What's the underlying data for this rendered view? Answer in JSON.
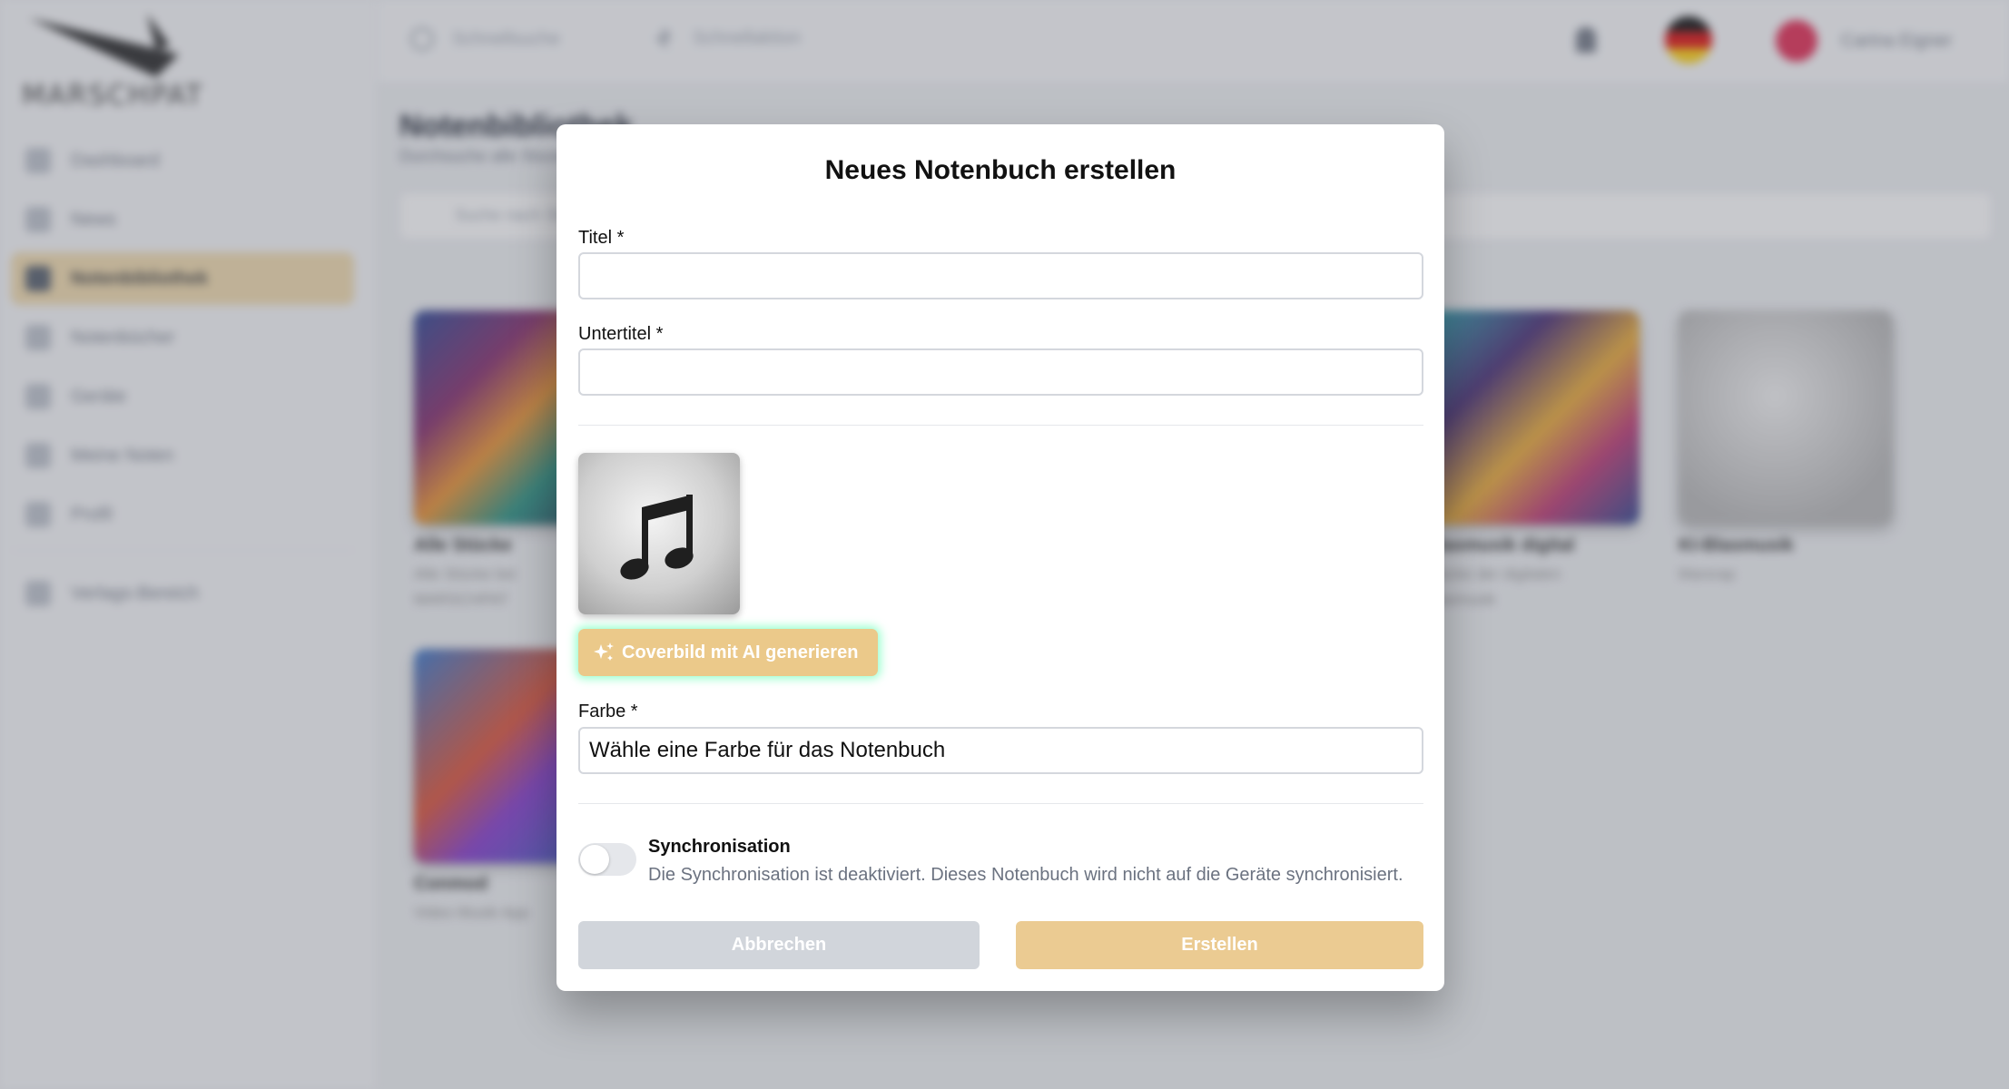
{
  "background": {
    "brand": "MARSCHPAT",
    "sidebar": {
      "items": [
        {
          "label": "Dashboard",
          "icon": "dashboard-icon",
          "active": false
        },
        {
          "label": "News",
          "icon": "news-icon",
          "active": false
        },
        {
          "label": "Notenbibliothek",
          "icon": "library-icon",
          "active": true
        },
        {
          "label": "Notenbücher",
          "icon": "book-icon",
          "active": false
        },
        {
          "label": "Geräte",
          "icon": "device-icon",
          "active": false
        },
        {
          "label": "Meine Noten",
          "icon": "notes-icon",
          "active": false
        },
        {
          "label": "Profil",
          "icon": "user-icon",
          "active": false
        }
      ],
      "secondary": {
        "label": "Verlags-Bereich",
        "icon": "publisher-icon"
      }
    },
    "topbar": {
      "search_placeholder": "Schnellsuche",
      "quick_label": "Schnellaktion",
      "user_name": "Carina Eigner",
      "flag_colors": [
        "#000000",
        "#dd0000",
        "#ffce00"
      ]
    },
    "main": {
      "title": "Notenbibliothek",
      "subtitle": "Durchsuche alle Stücke",
      "search_placeholder": "Suche nach Stücken"
    },
    "cards": [
      {
        "title": "Alle Stücke",
        "subtitle": "Alle Stücke bei",
        "subtitle2": "MARSCHPAT"
      },
      {
        "title": "Blasmusik digital",
        "subtitle": "Stücke der digitalen",
        "subtitle2": "Blasmusik"
      },
      {
        "title": "KI-Blasmusik",
        "subtitle": "Marsrap",
        "subtitle2": ""
      },
      {
        "title": "Conmod",
        "subtitle": "Video Musik App",
        "subtitle2": ""
      }
    ]
  },
  "modal": {
    "title": "Neues Notenbuch erstellen",
    "title_label": "Titel *",
    "title_value": "",
    "subtitle_label": "Untertitel *",
    "subtitle_value": "",
    "cover_icon": "music-note-icon",
    "ai_button_label": "Coverbild mit AI generieren",
    "color_label": "Farbe *",
    "color_placeholder": "Wähle eine Farbe für das Notenbuch",
    "sync_title": "Synchronisation",
    "sync_description": "Die Synchronisation ist deaktiviert. Dieses Notenbuch wird nicht auf die Geräte synchronisiert.",
    "sync_enabled": false,
    "cancel_label": "Abbrechen",
    "create_label": "Erstellen",
    "accent_color": "#ebcb92",
    "glow_color": "#78ffbe"
  }
}
